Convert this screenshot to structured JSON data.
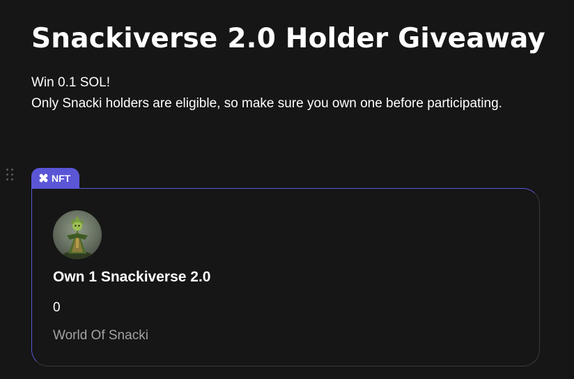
{
  "header": {
    "title": "Snackiverse 2.0 Holder Giveaway",
    "description_line1": "Win 0.1 SOL!",
    "description_line2": "Only Snacki holders are eligible, so make sure you own one before participating."
  },
  "task": {
    "tab_label": "NFT",
    "tab_icon": "nft-icon",
    "accent_color": "#5b56d6",
    "title": "Own 1 Snackiverse 2.0",
    "count": "0",
    "collection": "World Of Snacki"
  }
}
